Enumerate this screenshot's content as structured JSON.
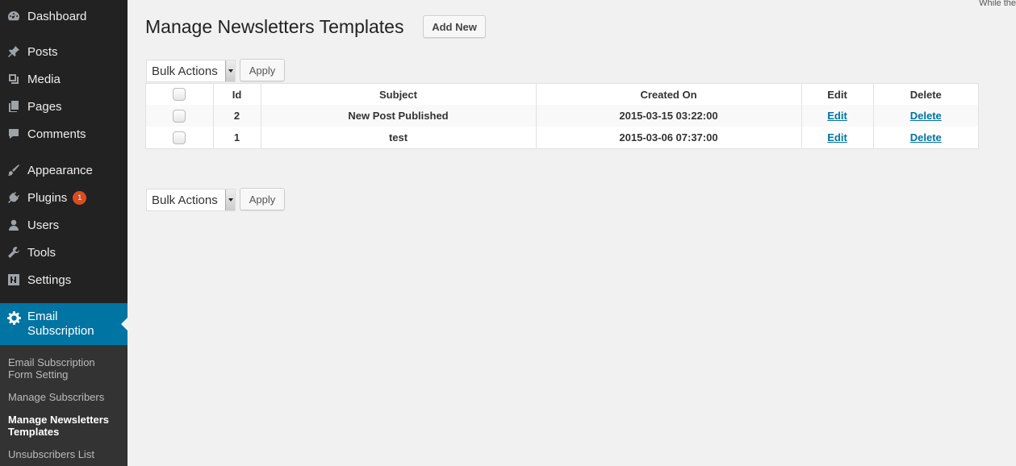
{
  "sidebar": {
    "items": [
      {
        "label": "Dashboard",
        "icon": "dashboard-icon"
      },
      {
        "label": "Posts",
        "icon": "pin-icon"
      },
      {
        "label": "Media",
        "icon": "media-icon"
      },
      {
        "label": "Pages",
        "icon": "pages-icon"
      },
      {
        "label": "Comments",
        "icon": "comment-icon"
      },
      {
        "label": "Appearance",
        "icon": "brush-icon"
      },
      {
        "label": "Plugins",
        "icon": "plug-icon",
        "badge": "1"
      },
      {
        "label": "Users",
        "icon": "user-icon"
      },
      {
        "label": "Tools",
        "icon": "wrench-icon"
      },
      {
        "label": "Settings",
        "icon": "settings-icon"
      }
    ],
    "active": {
      "label_line1": "Email",
      "label_line2": "Subscription",
      "icon": "gear-icon"
    },
    "submenu": [
      {
        "line1": "Email Subscription",
        "line2": "Form Setting"
      },
      {
        "line1": "Manage Subscribers",
        "line2": ""
      },
      {
        "line1": "Manage Newsletters",
        "line2": "Templates"
      },
      {
        "line1": "Unsubscribers List",
        "line2": ""
      }
    ]
  },
  "top_right_text": "While the",
  "page": {
    "title": "Manage Newsletters Templates",
    "add_new_label": "Add New"
  },
  "bulk": {
    "select_value": "Bulk Actions",
    "apply_label": "Apply"
  },
  "table": {
    "headers": [
      "Id",
      "Subject",
      "Created On",
      "Edit",
      "Delete"
    ],
    "rows": [
      {
        "id": "2",
        "subject": "New Post Published",
        "created": "2015-03-15 03:22:00",
        "edit": "Edit",
        "delete": "Delete"
      },
      {
        "id": "1",
        "subject": "test",
        "created": "2015-03-06 07:37:00",
        "edit": "Edit",
        "delete": "Delete"
      }
    ]
  },
  "colors": {
    "sidebar_bg": "#222222",
    "active_bg": "#0074a2",
    "link": "#0074a2",
    "badge": "#d54e21"
  }
}
